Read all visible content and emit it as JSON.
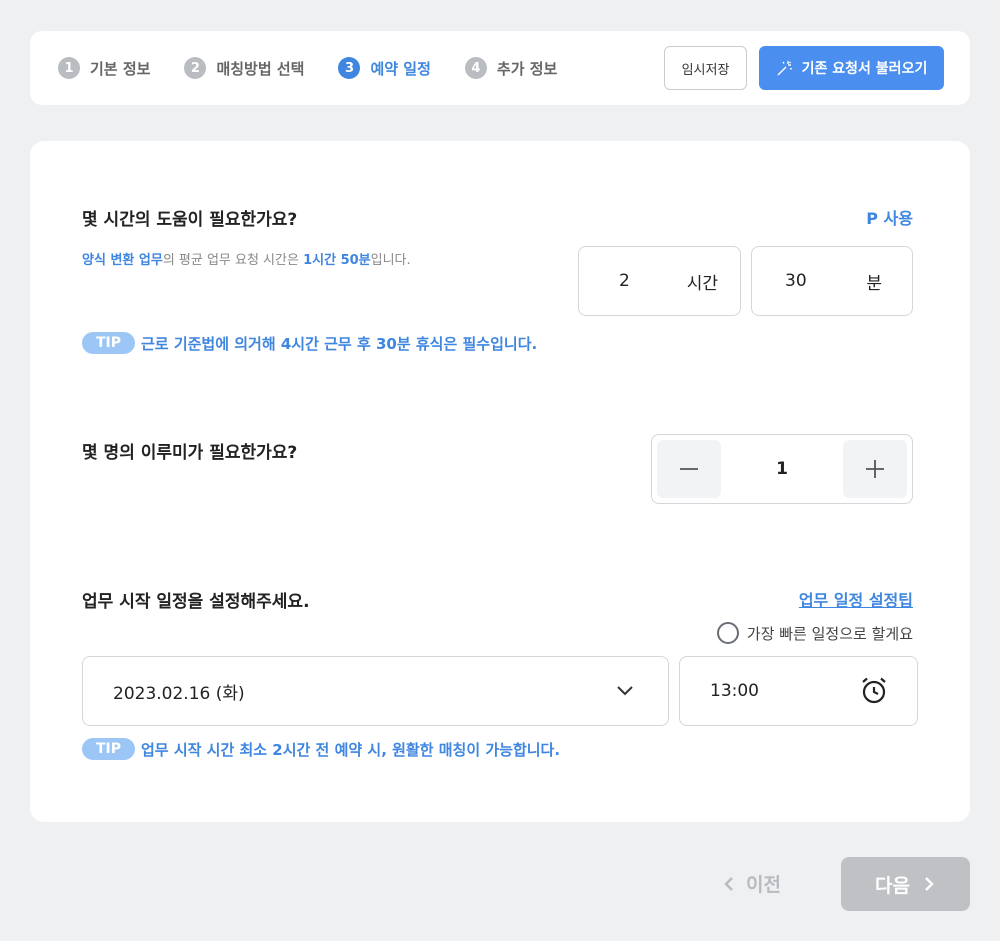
{
  "steps": [
    {
      "num": "1",
      "label": "기본 정보"
    },
    {
      "num": "2",
      "label": "매칭방법 선택"
    },
    {
      "num": "3",
      "label": "예약 일정"
    },
    {
      "num": "4",
      "label": "추가 정보"
    }
  ],
  "active_step": 3,
  "toolbar": {
    "temp_save": "임시저장",
    "load_request": "기존 요청서 불러오기"
  },
  "hours_section": {
    "question": "몇 시간의 도움이 필요한가요?",
    "p_use": "P 사용",
    "hint_task": "양식 변환 업무",
    "hint_mid": "의 평균 업무 요청 시간은 ",
    "hint_time": "1시간 50분",
    "hint_end": "입니다.",
    "hours_value": "2",
    "hours_unit": "시간",
    "minutes_value": "30",
    "minutes_unit": "분",
    "tip_badge": "TIP",
    "tip_text": "근로 기준법에 의거해 4시간 근무 후 30분 휴식은 필수입니다."
  },
  "people_section": {
    "question": "몇 명의 이루미가 필요한가요?",
    "count": "1"
  },
  "schedule_section": {
    "question": "업무 시작 일정을 설정해주세요.",
    "tip_link": "업무 일정 설정팁",
    "earliest_option": "가장 빠른 일정으로 할게요",
    "date_value": "2023.02.16 (화)",
    "time_value": "13:00",
    "tip_badge": "TIP",
    "tip_text": "업무 시작 시간 최소 2시간 전 예약 시, 원활한 매칭이 가능합니다."
  },
  "footer": {
    "prev": "이전",
    "next": "다음"
  },
  "colors": {
    "accent": "#3f86e0",
    "button_blue": "#4a8ef0",
    "disabled": "#bfc1c5"
  }
}
